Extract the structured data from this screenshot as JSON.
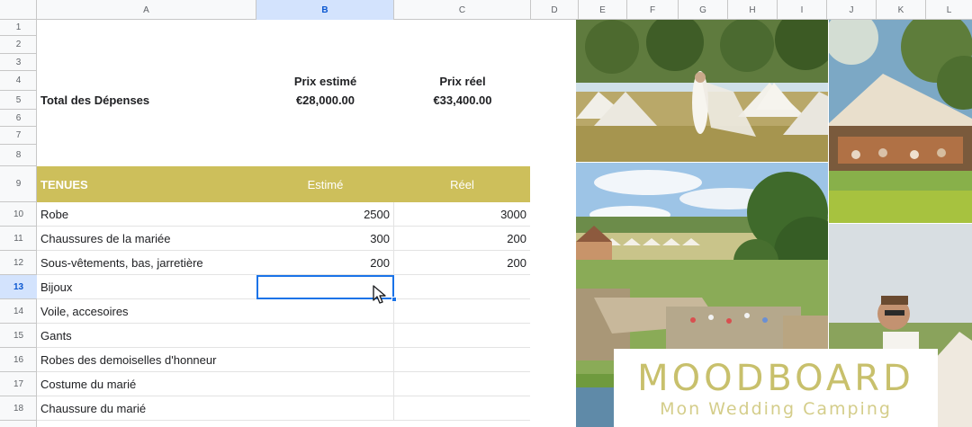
{
  "columns": [
    "A",
    "B",
    "C",
    "D",
    "E",
    "F",
    "G",
    "H",
    "I",
    "J",
    "K",
    "L"
  ],
  "rows": [
    "1",
    "2",
    "3",
    "4",
    "5",
    "6",
    "7",
    "8",
    "9",
    "10",
    "11",
    "12",
    "13",
    "14",
    "15",
    "16",
    "17",
    "18"
  ],
  "selected_column": "B",
  "selected_row": "13",
  "summary": {
    "label": "Total des Dépenses",
    "estimated_header": "Prix estimé",
    "actual_header": "Prix réel",
    "estimated_value": "€28,000.00",
    "actual_value": "€33,400.00"
  },
  "section": {
    "title": "TENUES",
    "estimated_header": "Estimé",
    "actual_header": "Réel",
    "band_color": "#cdbf5b"
  },
  "items": [
    {
      "label": "Robe",
      "estimated": "2500",
      "actual": "3000"
    },
    {
      "label": "Chaussures de la mariée",
      "estimated": "300",
      "actual": "200"
    },
    {
      "label": "Sous-vêtements, bas, jarretière",
      "estimated": "200",
      "actual": "200"
    },
    {
      "label": "Bijoux",
      "estimated": "",
      "actual": ""
    },
    {
      "label": "Voile, accesoires",
      "estimated": "",
      "actual": ""
    },
    {
      "label": "Gants",
      "estimated": "",
      "actual": ""
    },
    {
      "label": "Robes des demoiselles d'honneur",
      "estimated": "",
      "actual": ""
    },
    {
      "label": "Costume du marié",
      "estimated": "",
      "actual": ""
    },
    {
      "label": "Chaussure du marié",
      "estimated": "",
      "actual": ""
    }
  ],
  "moodboard": {
    "title": "MOODBOARD",
    "subtitle": "Mon Wedding Camping",
    "title_color": "#c8c06c",
    "accent_color": "#a9d3e6",
    "photos": [
      "bride-in-field-with-bell-tents",
      "reception-tent-with-guests",
      "chateau-venue-aerial-view",
      "groom-portrait"
    ]
  }
}
